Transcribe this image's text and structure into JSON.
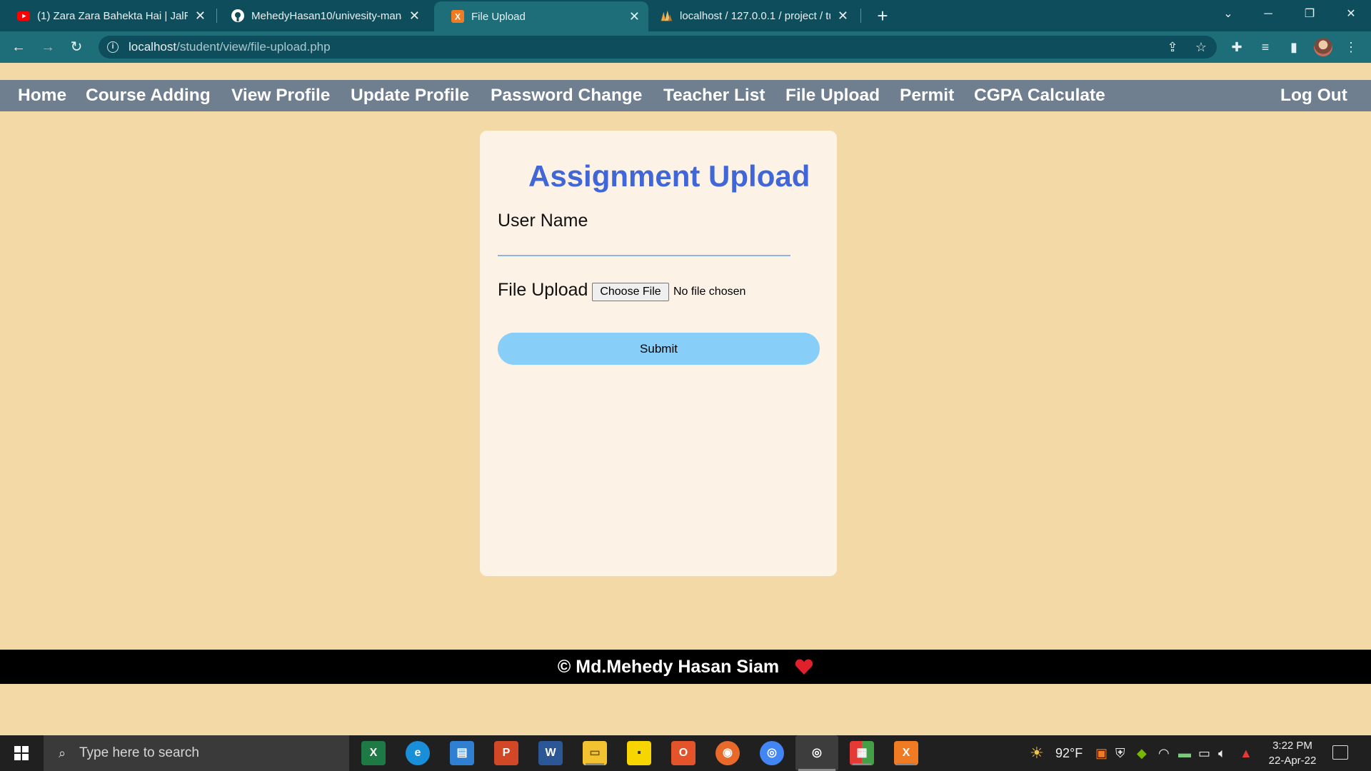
{
  "browser": {
    "tabs": [
      {
        "title": "(1) Zara Zara Bahekta Hai | JalRaj",
        "icon": "youtube-icon",
        "active": false
      },
      {
        "title": "MehedyHasan10/univesity-mana",
        "icon": "github-icon",
        "active": false
      },
      {
        "title": "File Upload",
        "icon": "xampp-icon",
        "active": true
      },
      {
        "title": "localhost / 127.0.0.1 / project / tu",
        "icon": "phpmyadmin-icon",
        "active": false
      }
    ],
    "url_host": "localhost",
    "url_path": "/student/view/file-upload.php"
  },
  "nav": {
    "items": [
      "Home",
      "Course Adding",
      "View Profile",
      "Update Profile",
      "Password Change",
      "Teacher List",
      "File Upload",
      "Permit",
      "CGPA Calculate"
    ],
    "logout": "Log Out"
  },
  "form": {
    "title": "Assignment Upload",
    "username_label": "User Name",
    "username_value": "",
    "file_label": "File Upload",
    "choose_file": "Choose File",
    "no_file": "No file chosen",
    "submit": "Submit"
  },
  "footer": {
    "text": "© Md.Mehedy Hasan Siam"
  },
  "taskbar": {
    "search_placeholder": "Type here to search",
    "weather": "92°F",
    "time": "3:22 PM",
    "date": "22-Apr-22"
  },
  "colors": {
    "page_bg": "#f3d9a6",
    "nav_bg": "#6f7f90",
    "title": "#4166d8",
    "submit_bg": "#87cef8",
    "footer_bg": "#000000",
    "heart": "#e0202a"
  }
}
